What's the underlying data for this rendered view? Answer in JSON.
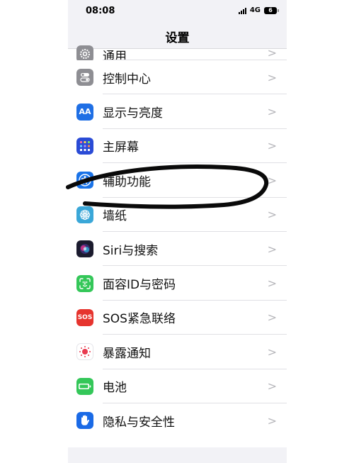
{
  "status": {
    "time": "08:08",
    "network": "4G",
    "battery": "6"
  },
  "nav": {
    "title": "设置"
  },
  "items": [
    {
      "label": "通用",
      "icon": "gear-icon",
      "color": "#8e8e93"
    },
    {
      "label": "控制中心",
      "icon": "toggles-icon",
      "color": "#8e8e93"
    },
    {
      "label": "显示与亮度",
      "icon": "text-size-icon",
      "color": "#1f6fe5"
    },
    {
      "label": "主屏幕",
      "icon": "app-grid-icon",
      "color": "#2a4bd6"
    },
    {
      "label": "辅助功能",
      "icon": "accessibility-icon",
      "color": "#1a73e8"
    },
    {
      "label": "墙纸",
      "icon": "flower-icon",
      "color": "#3aa7d8"
    },
    {
      "label": "Siri与搜索",
      "icon": "siri-icon",
      "color": "#1b1b2e"
    },
    {
      "label": "面容ID与密码",
      "icon": "face-id-icon",
      "color": "#34c759"
    },
    {
      "label": "SOS紧急联络",
      "icon": "sos-icon",
      "color": "#e6342e"
    },
    {
      "label": "暴露通知",
      "icon": "exposure-icon",
      "color": "#ffffff"
    },
    {
      "label": "电池",
      "icon": "battery-icon",
      "color": "#34c759"
    },
    {
      "label": "隐私与安全性",
      "icon": "hand-icon",
      "color": "#1a6ae6"
    }
  ]
}
